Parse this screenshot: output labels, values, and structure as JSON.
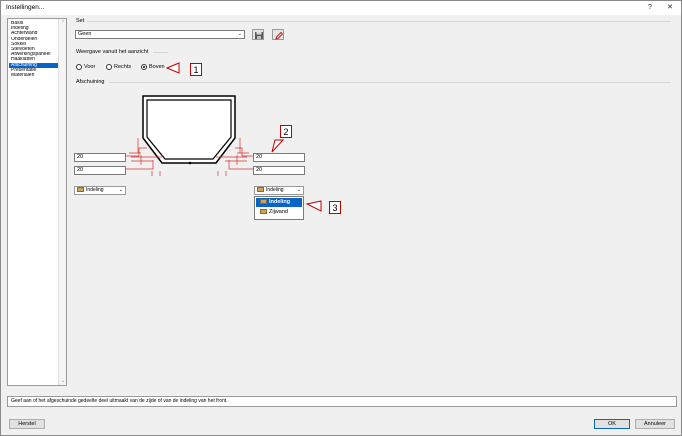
{
  "window": {
    "title": "Instellingen...",
    "help_glyph": "?",
    "close_glyph": "✕"
  },
  "sidebar": {
    "items": [
      {
        "label": "Basis",
        "selected": false
      },
      {
        "label": "Indeling",
        "selected": false
      },
      {
        "label": "Achterwand",
        "selected": false
      },
      {
        "label": "Onderdelen",
        "selected": false
      },
      {
        "label": "Sokkel",
        "selected": false
      },
      {
        "label": "Stelvoeten",
        "selected": false
      },
      {
        "label": "Afwerkingspaneel",
        "selected": false
      },
      {
        "label": "Haaklatten",
        "selected": false
      },
      {
        "label": "Afschuining",
        "selected": true
      },
      {
        "label": "Presentatie",
        "selected": false
      },
      {
        "label": "Materialen",
        "selected": false
      }
    ]
  },
  "set": {
    "label": "Set",
    "value": "Geen",
    "save_icon": "save-icon",
    "edit_icon": "pencil-icon"
  },
  "view": {
    "label": "Weergave vanuit het aanzicht",
    "options": [
      "Voor",
      "Rechts",
      "Boven"
    ],
    "selected": "Boven"
  },
  "bevel": {
    "label": "Afschuining",
    "left_top": "20",
    "left_bottom": "20",
    "right_top": "20",
    "right_bottom": "20",
    "left_dropdown": "Indeling",
    "right_dropdown": "Indeling",
    "dropdown_options": [
      "Indeling",
      "Zijwand"
    ],
    "dropdown_selected": "Indeling"
  },
  "callouts": [
    "1",
    "2",
    "3"
  ],
  "status_text": "Geef aan of het afgeschuinde gedeelte deel uitmaakt van de zijde of van de indeling van het front.",
  "buttons": {
    "reset": "Herstel",
    "ok": "OK",
    "cancel": "Annuleer"
  },
  "colors": {
    "selection": "#0a64c8",
    "callout_border": "#c00000",
    "dimension_line": "#d83030"
  }
}
